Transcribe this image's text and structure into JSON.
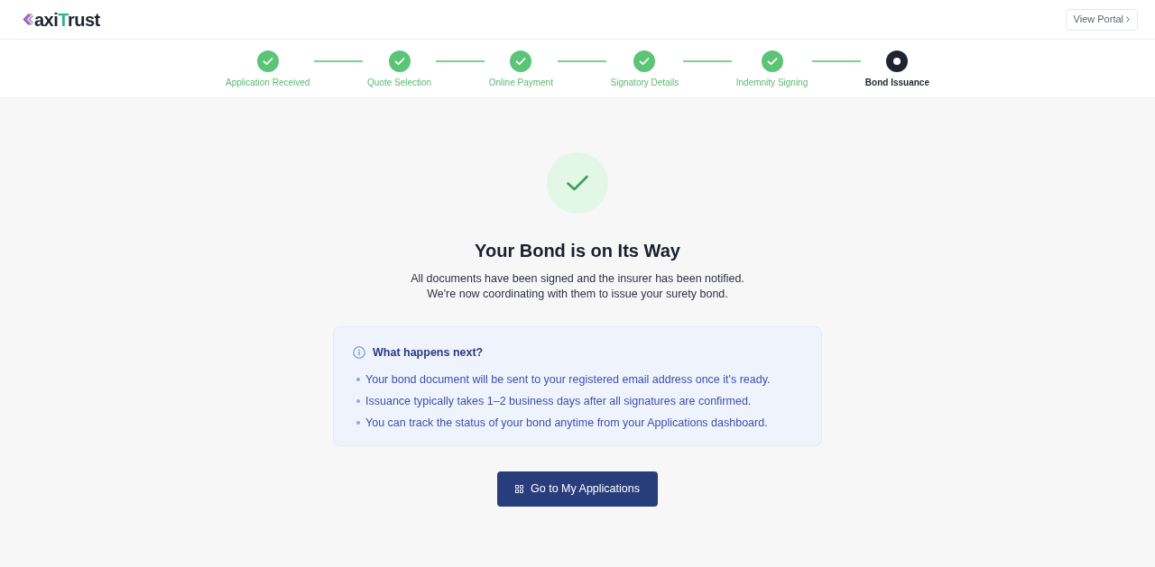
{
  "header": {
    "logo": {
      "lead": "axi",
      "accent": "T",
      "tail": "rust"
    },
    "portal_button": {
      "label": "View Portal"
    }
  },
  "steps": [
    {
      "label": "Application Received",
      "completed": true,
      "current": false
    },
    {
      "label": "Quote Selection",
      "completed": true,
      "current": false
    },
    {
      "label": "Online Payment",
      "completed": true,
      "current": false
    },
    {
      "label": "Signatory Details",
      "completed": true,
      "current": false
    },
    {
      "label": "Indemnity Signing",
      "completed": true,
      "current": false
    },
    {
      "label": "Bond Issuance",
      "completed": false,
      "current": true
    }
  ],
  "confirmation": {
    "title": "Your Bond is on Its Way",
    "description": [
      "All documents have been signed and the insurer has been notified.",
      "We're now coordinating with them to issue your surety bond."
    ]
  },
  "next_steps": {
    "title": "What happens next?",
    "items": [
      "Your bond document will be sent to your registered email address once it's ready.",
      "Issuance typically takes 1–2 business days after all signatures are confirmed.",
      "You can track the status of your bond anytime from your Applications dashboard."
    ]
  },
  "primary_button": {
    "label": "Go to My Applications"
  }
}
